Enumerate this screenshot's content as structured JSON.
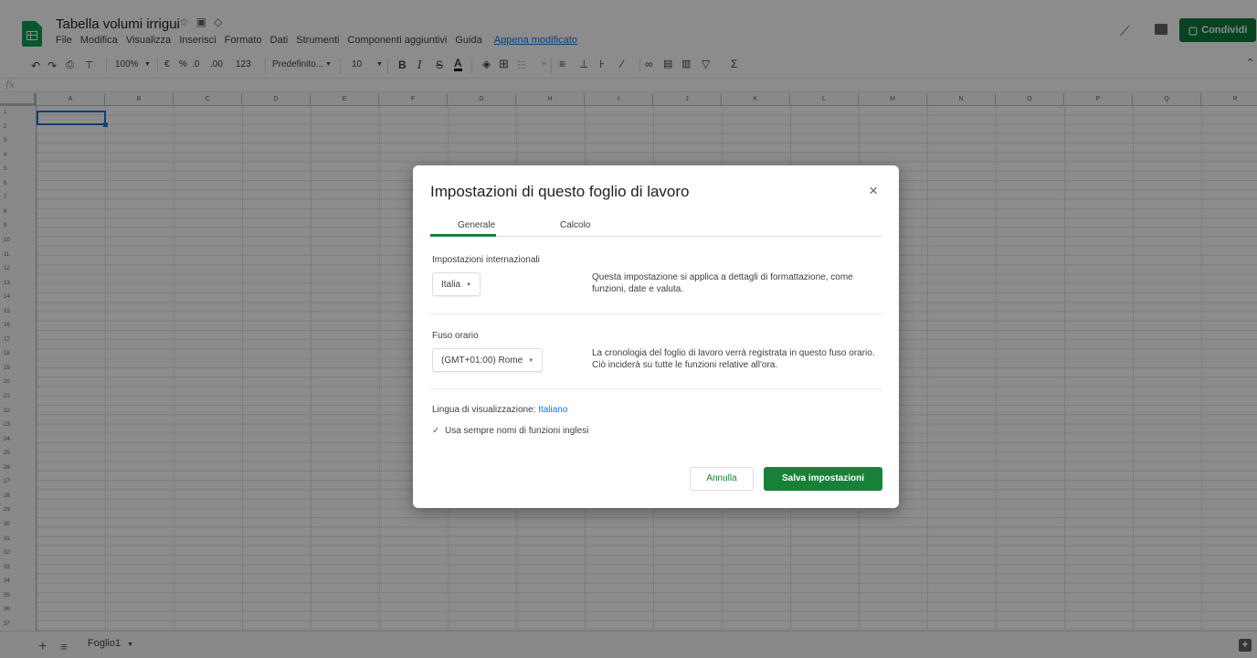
{
  "header": {
    "doc_title": "Tabella volumi irrigui",
    "share_label": "Condividi",
    "last_edit": "Appena modificato",
    "menu": [
      "File",
      "Modifica",
      "Visualizza",
      "Inserisci",
      "Formato",
      "Dati",
      "Strumenti",
      "Componenti aggiuntivi",
      "Guida"
    ]
  },
  "toolbar": {
    "zoom": "100%",
    "currency": "€",
    "percent": "%",
    "decimals_less": ".0",
    "decimals_more": ".00",
    "format_more": "123",
    "font": "Predefinito...",
    "font_size": "10",
    "bold": "B",
    "italic": "I",
    "strike": "S",
    "text_color": "A",
    "sum": "Σ"
  },
  "formula_bar": {
    "fx": "fx"
  },
  "grid": {
    "columns": [
      "A",
      "B",
      "C",
      "D",
      "E",
      "F",
      "G",
      "H",
      "I",
      "J",
      "K",
      "L",
      "M",
      "N",
      "O",
      "P",
      "Q",
      "R"
    ],
    "rows": [
      "1",
      "2",
      "3",
      "4",
      "5",
      "6",
      "7",
      "8",
      "9",
      "10",
      "11",
      "12",
      "13",
      "14",
      "15",
      "16",
      "17",
      "18",
      "19",
      "20",
      "21",
      "22",
      "23",
      "24",
      "25",
      "26",
      "27",
      "28",
      "29",
      "30",
      "31",
      "32",
      "33",
      "34",
      "35",
      "36",
      "37"
    ]
  },
  "bottom": {
    "sheet_name": "Foglio1"
  },
  "dialog": {
    "title": "Impostazioni di questo foglio di lavoro",
    "tabs": [
      "Generale",
      "Calcolo"
    ],
    "locale_label": "Impostazioni internazionali",
    "locale_value": "Italia",
    "locale_desc": "Questa impostazione si applica a dettagli di formattazione, come funzioni, date e valuta.",
    "tz_label": "Fuso orario",
    "tz_value": "(GMT+01:00) Rome",
    "tz_desc": "La cronologia del foglio di lavoro verrà registrata in questo fuso orario. Ciò inciderà su tutte le funzioni relative all'ora.",
    "lang_prefix": "Lingua di visualizzazione:",
    "lang_value": "Italiano",
    "checkbox_label": "Usa sempre nomi di funzioni inglesi",
    "checkbox_checked": true,
    "cancel_label": "Annulla",
    "save_label": "Salva impostazioni"
  },
  "colors": {
    "accent": "#188038",
    "share": "#0f7b3d",
    "link": "#1a73e8",
    "selection": "#1a73e8"
  }
}
